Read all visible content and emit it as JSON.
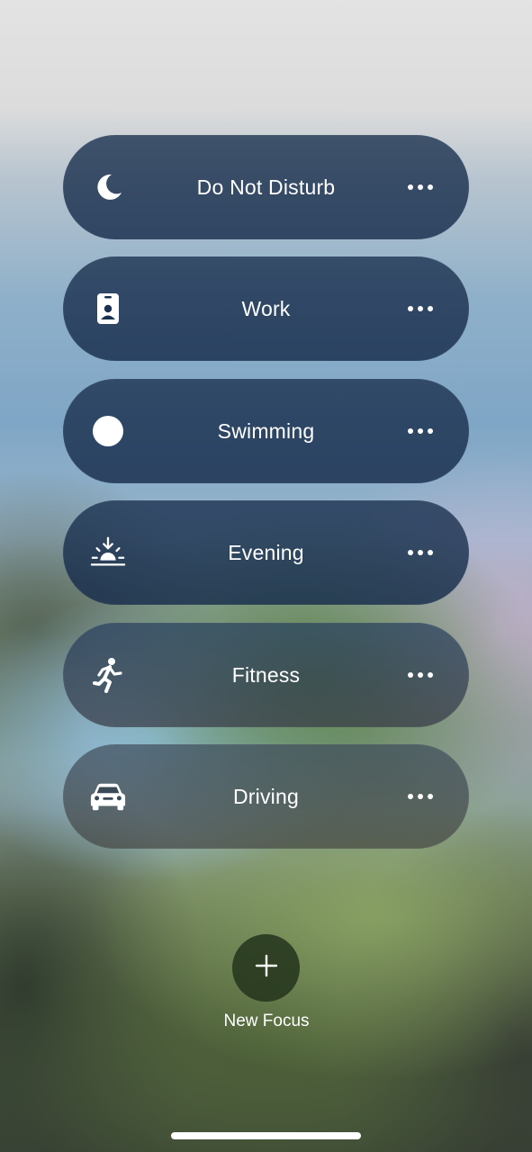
{
  "focus_modes": [
    {
      "label": "Do Not Disturb",
      "icon": "moon-icon"
    },
    {
      "label": "Work",
      "icon": "id-badge-icon"
    },
    {
      "label": "Swimming",
      "icon": "circle-icon"
    },
    {
      "label": "Evening",
      "icon": "sunset-icon"
    },
    {
      "label": "Fitness",
      "icon": "running-figure-icon"
    },
    {
      "label": "Driving",
      "icon": "car-icon"
    }
  ],
  "new_focus": {
    "label": "New Focus",
    "icon": "plus-icon"
  }
}
